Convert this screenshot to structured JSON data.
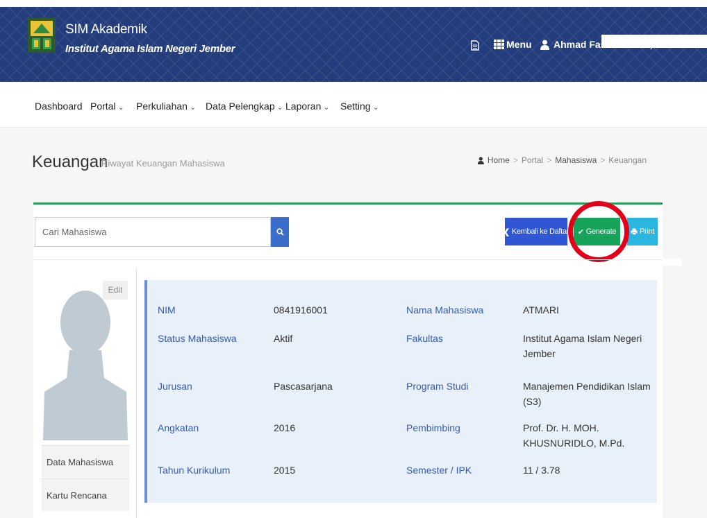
{
  "header": {
    "app_title": "SIM Akademik",
    "institution": "Institut Agama Islam Negeri Jember",
    "menu_label": "Menu",
    "user_name": "Ahmad Fasih Rosadi, S.E.",
    "icons": [
      "document-icon",
      "grid-icon",
      "user-icon",
      "caret-down-icon"
    ]
  },
  "nav": {
    "items": [
      {
        "label": "Dashboard",
        "dropdown": false
      },
      {
        "label": "Portal",
        "dropdown": true
      },
      {
        "label": "Perkuliahan",
        "dropdown": true
      },
      {
        "label": "Data Pelengkap",
        "dropdown": true
      },
      {
        "label": "Laporan",
        "dropdown": true
      },
      {
        "label": "Setting",
        "dropdown": true
      }
    ]
  },
  "page": {
    "title": "Keuangan",
    "subtitle": "Riwayat Keuangan Mahasiswa"
  },
  "breadcrumb": [
    "Home",
    "Portal",
    "Mahasiswa",
    "Keuangan"
  ],
  "search": {
    "placeholder": "Cari Mahasiswa"
  },
  "buttons": {
    "back": "Kembali ke Daftar",
    "generate": "Generate",
    "print": "Print"
  },
  "profile": {
    "edit_label": "Edit",
    "side_links": [
      "Data Mahasiswa",
      "Kartu Rencana Studi"
    ]
  },
  "student": {
    "left": [
      {
        "label": "NIM",
        "value": "0841916001"
      },
      {
        "label": "Status Mahasiswa",
        "value": "Aktif"
      },
      {
        "label": "Jurusan",
        "value": "Pascasarjana"
      },
      {
        "label": "Angkatan",
        "value": "2016"
      },
      {
        "label": "Tahun Kurikulum",
        "value": "2015"
      }
    ],
    "right": [
      {
        "label": "Nama Mahasiswa",
        "value": "ATMARI"
      },
      {
        "label": "Fakultas",
        "value": "Institut Agama Islam Negeri Jember"
      },
      {
        "label": "Program Studi",
        "value": "Manajemen Pendidikan Islam (S3)"
      },
      {
        "label": "Pembimbing",
        "value": "Prof. Dr. H. MOH. KHUSNURIDLO, M.Pd."
      },
      {
        "label": "Semester / IPK",
        "value": "11 / 3.78"
      }
    ]
  },
  "colors": {
    "header_bg": "#233d7c",
    "accent_green": "#17a35a",
    "button_blue": "#3056d3",
    "button_cyan": "#2bb6e0",
    "highlight_red": "#e3001b",
    "label_blue": "#3659b8"
  }
}
